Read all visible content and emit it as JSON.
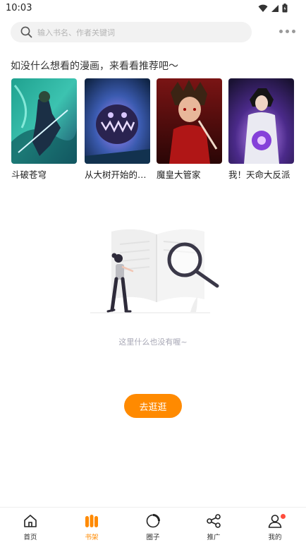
{
  "status_bar": {
    "time": "10:03"
  },
  "search": {
    "placeholder": "输入书名、作者关键词"
  },
  "recommend": {
    "title": "如没什么想看的漫画，来看看推荐吧〜",
    "items": [
      {
        "title": "斗破苍穹"
      },
      {
        "title": "从大树开始的进化"
      },
      {
        "title": "魔皇大管家"
      },
      {
        "title": "我！天命大反派"
      }
    ]
  },
  "empty_state": {
    "message": "这里什么也没有喔~"
  },
  "go_button": {
    "label": "去逛逛"
  },
  "tabs": [
    {
      "label": "首页",
      "icon": "home-icon"
    },
    {
      "label": "书架",
      "icon": "bookshelf-icon"
    },
    {
      "label": "圈子",
      "icon": "circle-icon"
    },
    {
      "label": "推广",
      "icon": "share-icon"
    },
    {
      "label": "我的",
      "icon": "profile-icon"
    }
  ],
  "colors": {
    "accent": "#ff8a00",
    "badge": "#ff4d3d"
  }
}
